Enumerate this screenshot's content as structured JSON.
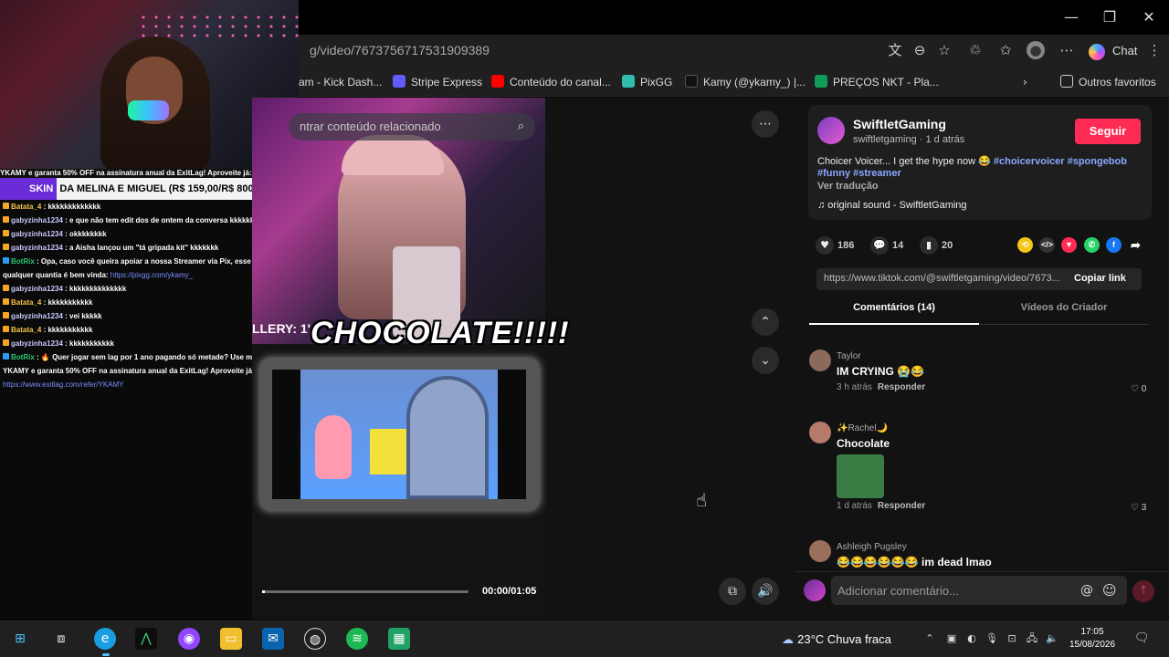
{
  "window": {
    "minimize": "—",
    "restore": "❐",
    "close": "✕"
  },
  "browser": {
    "url": "g/video/7673756717531909389",
    "chat_label": "Chat",
    "bookmarks": [
      "am - Kick Dash...",
      "Stripe Express",
      "Conteúdo do canal...",
      "PixGG",
      "Kamy (@ykamy_) |...",
      "PREÇOS NKT - Pla...",
      "Outros favoritos"
    ],
    "bookmark_colors": [
      "#53fc18",
      "#635bff",
      "#ff0000",
      "#32bcad",
      "#111111",
      "#0f9d58",
      "#777777"
    ]
  },
  "stream": {
    "promo": "YKAMY e garanta 50% OFF na assinatura anual da ExitLag! Aproveite já:",
    "skin_tag": "SKIN",
    "skin_text": " DA MELINA E MIGUEL (R$ 159,00/R$ 800,00)",
    "chat": [
      {
        "user": "Batata_4",
        "msg": " : kkkkkkkkkkkkk",
        "type": "u2"
      },
      {
        "user": "gabyzinha1234",
        "msg": " : e que não tem edit dos de ontem da conversa kkkkkk",
        "type": "u1"
      },
      {
        "user": "gabyzinha1234",
        "msg": " : okkkkkkkk",
        "type": "u1"
      },
      {
        "user": "gabyzinha1234",
        "msg": " : a Aisha lançou um \"tá gripada kit\" kkkkkkk",
        "type": "u1"
      },
      {
        "user": "BotRix",
        "msg": " : Opa, caso você queira apoiar a nossa Streamer via Pix, esse é o link,",
        "type": "u3"
      },
      {
        "user": "",
        "msg": "qualquer quantia é bem vinda: ",
        "type": "cont",
        "link": "https://pixgg.com/ykamy_"
      },
      {
        "user": "gabyzinha1234",
        "msg": " : kkkkkkkkkkkkkk",
        "type": "u1"
      },
      {
        "user": "Batata_4",
        "msg": " : kkkkkkkkkkk",
        "type": "u2"
      },
      {
        "user": "gabyzinha1234",
        "msg": " : vei kkkkk",
        "type": "u1"
      },
      {
        "user": "Batata_4",
        "msg": " : kkkkkkkkkkk",
        "type": "u2"
      },
      {
        "user": "gabyzinha1234",
        "msg": " : kkkkkkkkkkk",
        "type": "u1"
      },
      {
        "user": "BotRix",
        "msg": " : 🔥 Quer jogar sem lag por 1 ano pagando só metade? Use meu cupom",
        "type": "u3"
      },
      {
        "user": "",
        "msg": "YKAMY e garanta 50% OFF na assinatura anual da ExitLag! Aproveite já:",
        "type": "cont"
      },
      {
        "user": "",
        "msg": "",
        "type": "cont",
        "link": "https://www.exitlag.com/refer/YKAMY"
      }
    ]
  },
  "video": {
    "search_placeholder": "ntrar conteúdo relacionado",
    "overlay_left": "LLERY: 1'",
    "overlay_text": "CHOCOLATE!!!!!",
    "time": "00:00/01:05",
    "progress": 0.01
  },
  "post": {
    "creator": "SwiftletGaming",
    "meta": "swiftletgaming · 1 d atrás",
    "follow": "Seguir",
    "caption": "Choicer Voicer... I get the hype now 😂 ",
    "hashtags": [
      "#choicervoicer",
      "#spongebob",
      "#funny",
      "#streamer"
    ],
    "translate": "Ver tradução",
    "sound": "♫  original sound - SwiftletGaming",
    "likes": "186",
    "comments_count": "14",
    "saves": "20",
    "link": "https://www.tiktok.com/@swiftletgaming/video/7673...",
    "copy_link": "Copiar link",
    "tab_comments": "Comentários (14)",
    "tab_videos": "Vídeos do Criador"
  },
  "comments": [
    {
      "user": "Taylor",
      "text": "IM CRYING 😭😂",
      "time": "3 h atrás",
      "reply": "Responder",
      "likes": "0"
    },
    {
      "user": "✨Rachel🌙",
      "text": "Chocolate",
      "time": "1 d atrás",
      "reply": "Responder",
      "likes": "3"
    },
    {
      "user": "Ashleigh Pugsley",
      "text": "😂😂😂😂😂😂 im dead lmao",
      "time": "",
      "reply": "",
      "likes": ""
    }
  ],
  "comment_input": {
    "placeholder": "Adicionar comentário..."
  },
  "taskbar": {
    "weather": "23°C  Chuva fraca",
    "time": "17:05",
    "date": "15/08/2026"
  }
}
